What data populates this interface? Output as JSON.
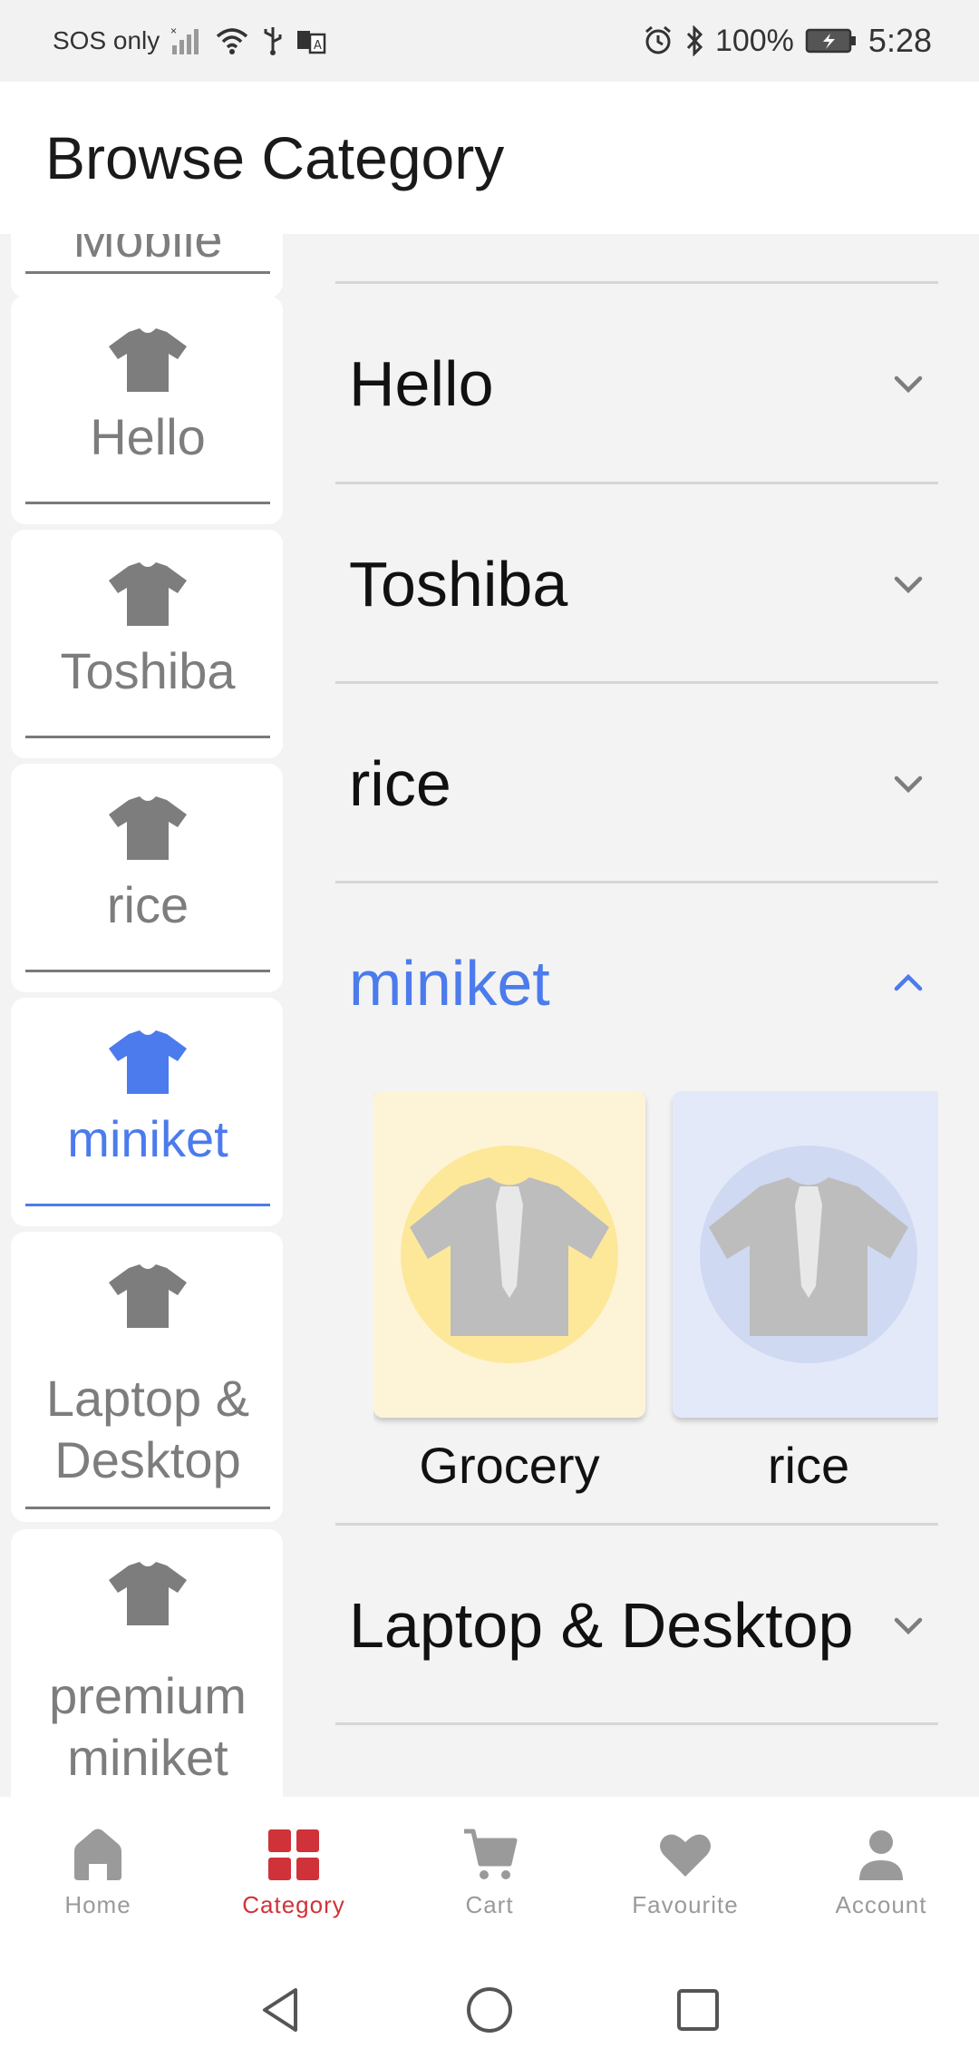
{
  "status_bar": {
    "carrier": "SOS only",
    "battery": "100%",
    "time": "5:28"
  },
  "app_bar": {
    "title": "Browse Category"
  },
  "rail": {
    "partial_label": "Mobile",
    "items": [
      {
        "label": "Hello",
        "icon": "tshirt-icon",
        "active": false
      },
      {
        "label": "Toshiba",
        "icon": "tshirt-icon",
        "active": false
      },
      {
        "label": "rice",
        "icon": "tshirt-icon",
        "active": false
      },
      {
        "label": "miniket",
        "icon": "tshirt-icon",
        "active": true
      },
      {
        "label": "Laptop & Desktop",
        "icon": "tshirt-icon",
        "active": false
      },
      {
        "label": "premium miniket",
        "icon": "tshirt-icon",
        "active": false
      }
    ]
  },
  "accordion": {
    "sections": [
      {
        "title": "Hello",
        "expanded": false
      },
      {
        "title": "Toshiba",
        "expanded": false
      },
      {
        "title": "rice",
        "expanded": false
      },
      {
        "title": "miniket",
        "expanded": true
      },
      {
        "title": "Laptop & Desktop",
        "expanded": false
      }
    ],
    "subcategories": [
      {
        "label": "Grocery",
        "bg": "#fdf4d8",
        "circle": "#fde89a"
      },
      {
        "label": "rice",
        "bg": "#e3e9f9",
        "circle": "#cfd9f1"
      }
    ]
  },
  "bottom_nav": {
    "items": [
      {
        "label": "Home",
        "icon": "home-icon",
        "active": false
      },
      {
        "label": "Category",
        "icon": "grid-icon",
        "active": true
      },
      {
        "label": "Cart",
        "icon": "cart-icon",
        "active": false
      },
      {
        "label": "Favourite",
        "icon": "heart-icon",
        "active": false
      },
      {
        "label": "Account",
        "icon": "person-icon",
        "active": false
      }
    ]
  },
  "colors": {
    "accent_blue": "#4b7bec",
    "active_red": "#d0323a",
    "muted_gray": "#7d7d7d"
  }
}
